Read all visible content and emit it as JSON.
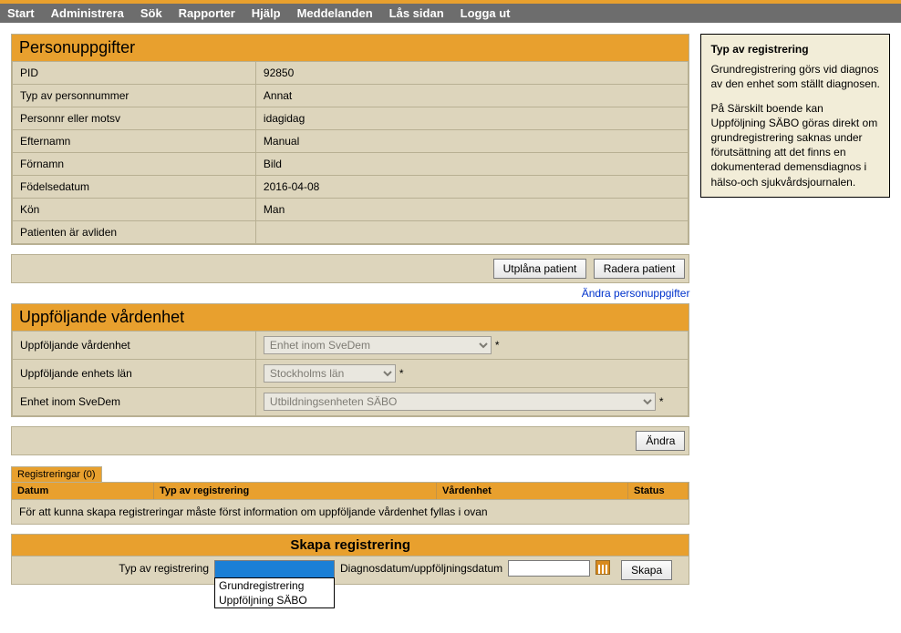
{
  "menu": [
    "Start",
    "Administrera",
    "Sök",
    "Rapporter",
    "Hjälp",
    "Meddelanden",
    "Lås sidan",
    "Logga ut"
  ],
  "sidebox": {
    "title": "Typ av registrering",
    "p1": "Grundregistrering görs vid diagnos av den enhet som ställt diagnosen.",
    "p2": "På Särskilt boende kan Uppföljning SÄBO göras direkt om grundregistrering saknas under förutsättning att det finns en dokumenterad demensdiagnos i hälso-och sjukvårdsjournalen."
  },
  "person": {
    "header": "Personuppgifter",
    "rows": [
      {
        "k": "PID",
        "v": "92850"
      },
      {
        "k": "Typ av personnummer",
        "v": "Annat"
      },
      {
        "k": "Personnr eller motsv",
        "v": "idagidag"
      },
      {
        "k": "Efternamn",
        "v": "Manual"
      },
      {
        "k": "Förnamn",
        "v": "Bild"
      },
      {
        "k": "Födelsedatum",
        "v": "2016-04-08"
      },
      {
        "k": "Kön",
        "v": "Man"
      },
      {
        "k": "Patienten är avliden",
        "v": ""
      }
    ],
    "btn_wipe": "Utplåna patient",
    "btn_delete": "Radera patient",
    "link_edit": "Ändra personuppgifter"
  },
  "follow": {
    "header": "Uppföljande vårdenhet",
    "rows": [
      {
        "k": "Uppföljande vårdenhet",
        "sel": "Enhet inom SveDem",
        "cls": "sel-wide"
      },
      {
        "k": "Uppföljande enhets län",
        "sel": "Stockholms län",
        "cls": "sel-mid"
      },
      {
        "k": "Enhet inom SveDem",
        "sel": "Utbildningsenheten SÄBO",
        "cls": "sel-full"
      }
    ],
    "btn_change": "Ändra"
  },
  "regs": {
    "tab": "Registreringar (0)",
    "cols": {
      "datum": "Datum",
      "typ": "Typ av registrering",
      "vard": "Vårdenhet",
      "status": "Status"
    },
    "info": "För att kunna skapa registreringar måste först information om uppföljande vårdenhet fyllas i ovan"
  },
  "create": {
    "header": "Skapa registrering",
    "label_type": "Typ av registrering",
    "options": [
      "Grundregistrering",
      "Uppföljning SÄBO"
    ],
    "label_date": "Diagnosdatum/uppföljningsdatum",
    "btn": "Skapa"
  }
}
